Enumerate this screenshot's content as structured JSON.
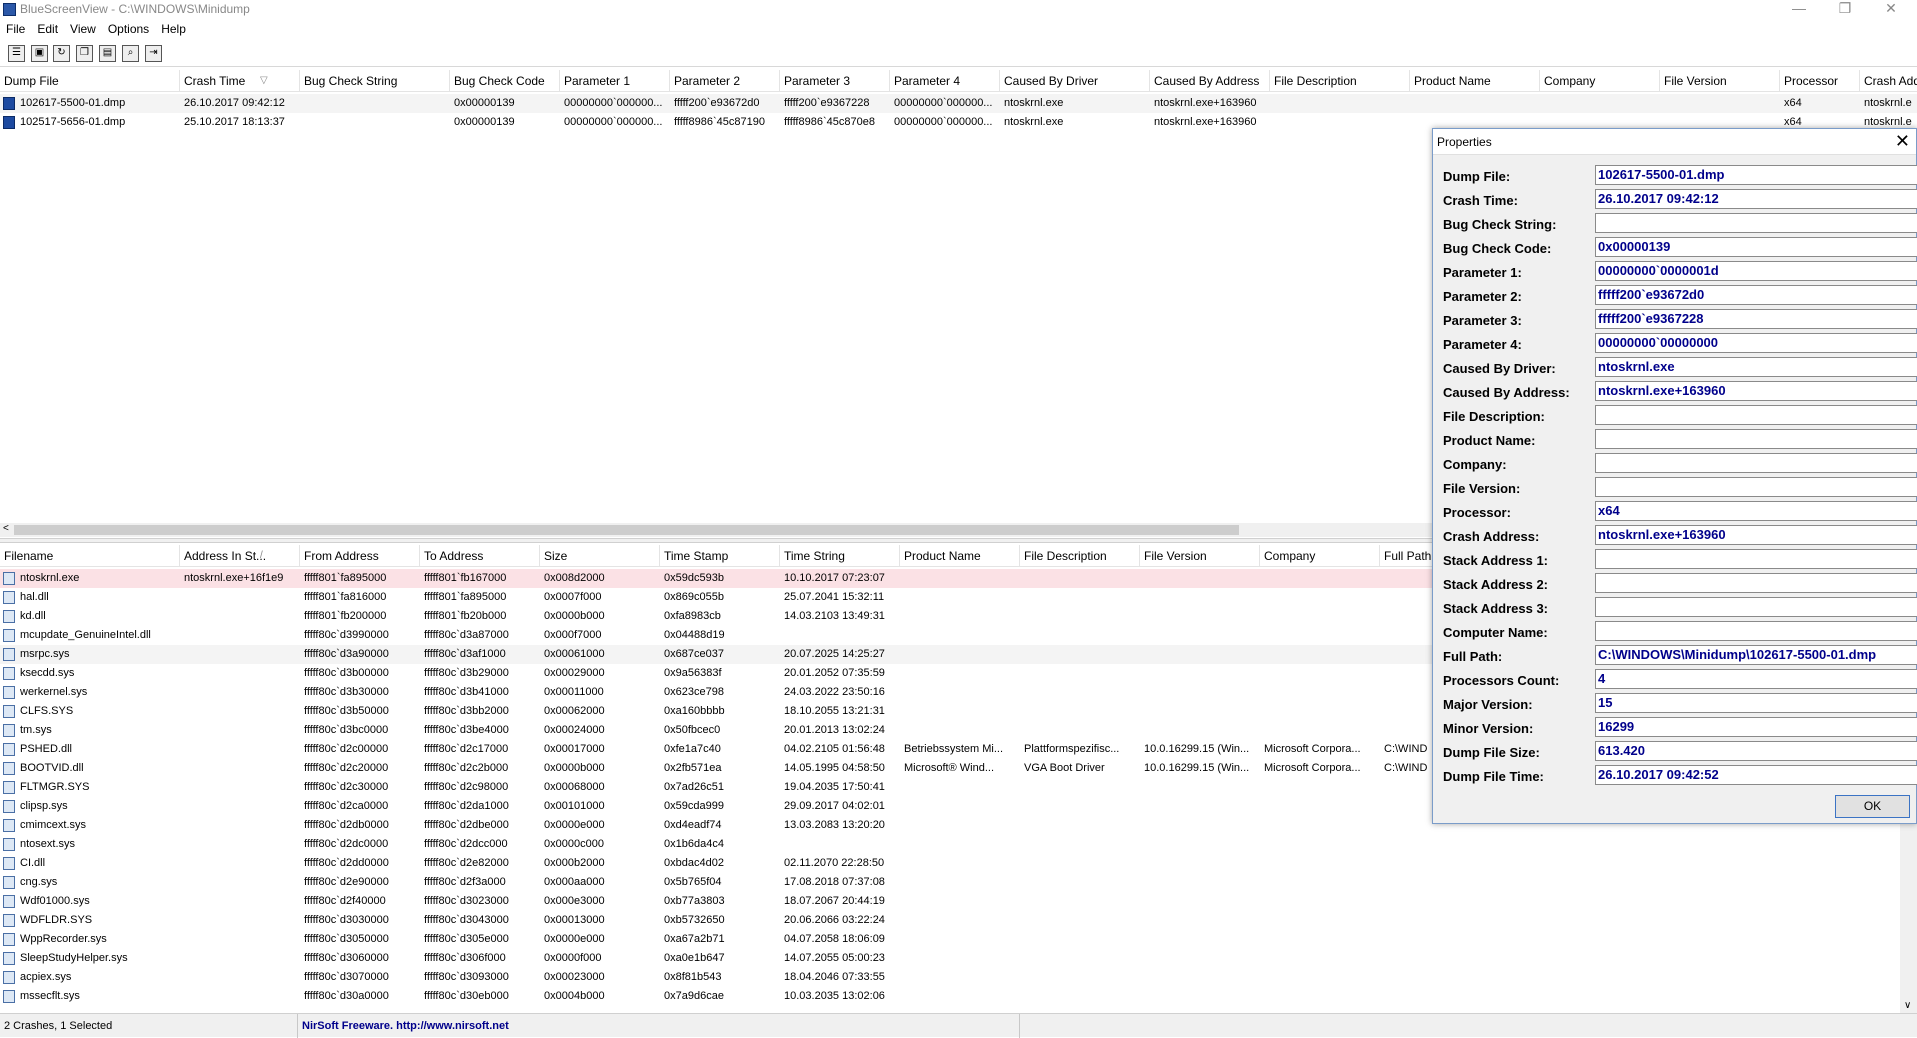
{
  "window": {
    "title": "BlueScreenView  -  C:\\WINDOWS\\Minidump",
    "min": "—",
    "max": "❐",
    "close": "✕"
  },
  "menu": [
    "File",
    "Edit",
    "View",
    "Options",
    "Help"
  ],
  "upper": {
    "columns": [
      "Dump File",
      "Crash Time",
      "Bug Check String",
      "Bug Check Code",
      "Parameter 1",
      "Parameter 2",
      "Parameter 3",
      "Parameter 4",
      "Caused By Driver",
      "Caused By Address",
      "File Description",
      "Product Name",
      "Company",
      "File Version",
      "Processor",
      "Crash Add"
    ],
    "sort_marker": "▽",
    "rows": [
      [
        "102617-5500-01.dmp",
        "26.10.2017 09:42:12",
        "",
        "0x00000139",
        "00000000`000000...",
        "fffff200`e93672d0",
        "fffff200`e9367228",
        "00000000`000000...",
        "ntoskrnl.exe",
        "ntoskrnl.exe+163960",
        "",
        "",
        "",
        "",
        "x64",
        "ntoskrnl.e"
      ],
      [
        "102517-5656-01.dmp",
        "25.10.2017 18:13:37",
        "",
        "0x00000139",
        "00000000`000000...",
        "fffff8986`45c87190",
        "fffff8986`45c870e8",
        "00000000`000000...",
        "ntoskrnl.exe",
        "ntoskrnl.exe+163960",
        "",
        "",
        "",
        "",
        "x64",
        "ntoskrnl.e"
      ]
    ]
  },
  "lower": {
    "columns": [
      "Filename",
      "Address In St...",
      "From Address",
      "To Address",
      "Size",
      "Time Stamp",
      "Time String",
      "Product Name",
      "File Description",
      "File Version",
      "Company",
      "Full Path"
    ],
    "sort_marker": "/",
    "rows": [
      [
        "ntoskrnl.exe",
        "ntoskrnl.exe+16f1e9",
        "fffff801`fa895000",
        "fffff801`fb167000",
        "0x008d2000",
        "0x59dc593b",
        "10.10.2017 07:23:07",
        "",
        "",
        "",
        "",
        ""
      ],
      [
        "hal.dll",
        "",
        "fffff801`fa816000",
        "fffff801`fa895000",
        "0x0007f000",
        "0x869c055b",
        "25.07.2041 15:32:11",
        "",
        "",
        "",
        "",
        ""
      ],
      [
        "kd.dll",
        "",
        "fffff801`fb200000",
        "fffff801`fb20b000",
        "0x0000b000",
        "0xfa8983cb",
        "14.03.2103 13:49:31",
        "",
        "",
        "",
        "",
        ""
      ],
      [
        "mcupdate_GenuineIntel.dll",
        "",
        "fffff80c`d3990000",
        "fffff80c`d3a87000",
        "0x000f7000",
        "0x04488d19",
        "",
        "",
        "",
        "",
        "",
        ""
      ],
      [
        "msrpc.sys",
        "",
        "fffff80c`d3a90000",
        "fffff80c`d3af1000",
        "0x00061000",
        "0x687ce037",
        "20.07.2025 14:25:27",
        "",
        "",
        "",
        "",
        ""
      ],
      [
        "ksecdd.sys",
        "",
        "fffff80c`d3b00000",
        "fffff80c`d3b29000",
        "0x00029000",
        "0x9a56383f",
        "20.01.2052 07:35:59",
        "",
        "",
        "",
        "",
        ""
      ],
      [
        "werkernel.sys",
        "",
        "fffff80c`d3b30000",
        "fffff80c`d3b41000",
        "0x00011000",
        "0x623ce798",
        "24.03.2022 23:50:16",
        "",
        "",
        "",
        "",
        ""
      ],
      [
        "CLFS.SYS",
        "",
        "fffff80c`d3b50000",
        "fffff80c`d3bb2000",
        "0x00062000",
        "0xa160bbbb",
        "18.10.2055 13:21:31",
        "",
        "",
        "",
        "",
        ""
      ],
      [
        "tm.sys",
        "",
        "fffff80c`d3bc0000",
        "fffff80c`d3be4000",
        "0x00024000",
        "0x50fbcec0",
        "20.01.2013 13:02:24",
        "",
        "",
        "",
        "",
        ""
      ],
      [
        "PSHED.dll",
        "",
        "fffff80c`d2c00000",
        "fffff80c`d2c17000",
        "0x00017000",
        "0xfe1a7c40",
        "04.02.2105 01:56:48",
        "Betriebssystem Mi...",
        "Plattformspezifisc...",
        "10.0.16299.15 (Win...",
        "Microsoft Corpora...",
        "C:\\WIND"
      ],
      [
        "BOOTVID.dll",
        "",
        "fffff80c`d2c20000",
        "fffff80c`d2c2b000",
        "0x0000b000",
        "0x2fb571ea",
        "14.05.1995 04:58:50",
        "Microsoft® Wind...",
        "VGA Boot Driver",
        "10.0.16299.15 (Win...",
        "Microsoft Corpora...",
        "C:\\WIND"
      ],
      [
        "FLTMGR.SYS",
        "",
        "fffff80c`d2c30000",
        "fffff80c`d2c98000",
        "0x00068000",
        "0x7ad26c51",
        "19.04.2035 17:50:41",
        "",
        "",
        "",
        "",
        ""
      ],
      [
        "clipsp.sys",
        "",
        "fffff80c`d2ca0000",
        "fffff80c`d2da1000",
        "0x00101000",
        "0x59cda999",
        "29.09.2017 04:02:01",
        "",
        "",
        "",
        "",
        ""
      ],
      [
        "cmimcext.sys",
        "",
        "fffff80c`d2db0000",
        "fffff80c`d2dbe000",
        "0x0000e000",
        "0xd4eadf74",
        "13.03.2083 13:20:20",
        "",
        "",
        "",
        "",
        ""
      ],
      [
        "ntosext.sys",
        "",
        "fffff80c`d2dc0000",
        "fffff80c`d2dcc000",
        "0x0000c000",
        "0x1b6da4c4",
        "",
        "",
        "",
        "",
        "",
        ""
      ],
      [
        "CI.dll",
        "",
        "fffff80c`d2dd0000",
        "fffff80c`d2e82000",
        "0x000b2000",
        "0xbdac4d02",
        "02.11.2070 22:28:50",
        "",
        "",
        "",
        "",
        ""
      ],
      [
        "cng.sys",
        "",
        "fffff80c`d2e90000",
        "fffff80c`d2f3a000",
        "0x000aa000",
        "0x5b765f04",
        "17.08.2018 07:37:08",
        "",
        "",
        "",
        "",
        ""
      ],
      [
        "Wdf01000.sys",
        "",
        "fffff80c`d2f40000",
        "fffff80c`d3023000",
        "0x000e3000",
        "0xb77a3803",
        "18.07.2067 20:44:19",
        "",
        "",
        "",
        "",
        ""
      ],
      [
        "WDFLDR.SYS",
        "",
        "fffff80c`d3030000",
        "fffff80c`d3043000",
        "0x00013000",
        "0xb5732650",
        "20.06.2066 03:22:24",
        "",
        "",
        "",
        "",
        ""
      ],
      [
        "WppRecorder.sys",
        "",
        "fffff80c`d3050000",
        "fffff80c`d305e000",
        "0x0000e000",
        "0xa67a2b71",
        "04.07.2058 18:06:09",
        "",
        "",
        "",
        "",
        ""
      ],
      [
        "SleepStudyHelper.sys",
        "",
        "fffff80c`d3060000",
        "fffff80c`d306f000",
        "0x0000f000",
        "0xa0e1b647",
        "14.07.2055 05:00:23",
        "",
        "",
        "",
        "",
        ""
      ],
      [
        "acpiex.sys",
        "",
        "fffff80c`d3070000",
        "fffff80c`d3093000",
        "0x00023000",
        "0x8f81b543",
        "18.04.2046 07:33:55",
        "",
        "",
        "",
        "",
        ""
      ],
      [
        "mssecflt.sys",
        "",
        "fffff80c`d30a0000",
        "fffff80c`d30eb000",
        "0x0004b000",
        "0x7a9d6cae",
        "10.03.2035 13:02:06",
        "",
        "",
        "",
        "",
        ""
      ]
    ]
  },
  "status": {
    "count": "2 Crashes, 1 Selected",
    "credit": "NirSoft Freeware.  http://www.nirsoft.net"
  },
  "properties": {
    "title": "Properties",
    "close": "✕",
    "ok": "OK",
    "fields": [
      {
        "label": "Dump File:",
        "value": "102617-5500-01.dmp"
      },
      {
        "label": "Crash Time:",
        "value": "26.10.2017 09:42:12"
      },
      {
        "label": "Bug Check String:",
        "value": ""
      },
      {
        "label": "Bug Check Code:",
        "value": "0x00000139"
      },
      {
        "label": "Parameter 1:",
        "value": "00000000`0000001d"
      },
      {
        "label": "Parameter 2:",
        "value": "fffff200`e93672d0"
      },
      {
        "label": "Parameter 3:",
        "value": "fffff200`e9367228"
      },
      {
        "label": "Parameter 4:",
        "value": "00000000`00000000"
      },
      {
        "label": "Caused By Driver:",
        "value": "ntoskrnl.exe"
      },
      {
        "label": "Caused By Address:",
        "value": "ntoskrnl.exe+163960"
      },
      {
        "label": "File Description:",
        "value": ""
      },
      {
        "label": "Product Name:",
        "value": ""
      },
      {
        "label": "Company:",
        "value": ""
      },
      {
        "label": "File Version:",
        "value": ""
      },
      {
        "label": "Processor:",
        "value": "x64"
      },
      {
        "label": "Crash Address:",
        "value": "ntoskrnl.exe+163960"
      },
      {
        "label": "Stack Address 1:",
        "value": ""
      },
      {
        "label": "Stack Address 2:",
        "value": ""
      },
      {
        "label": "Stack Address 3:",
        "value": ""
      },
      {
        "label": "Computer Name:",
        "value": ""
      },
      {
        "label": "Full Path:",
        "value": "C:\\WINDOWS\\Minidump\\102617-5500-01.dmp"
      },
      {
        "label": "Processors Count:",
        "value": "4"
      },
      {
        "label": "Major Version:",
        "value": "15"
      },
      {
        "label": "Minor Version:",
        "value": "16299"
      },
      {
        "label": "Dump File Size:",
        "value": "613.420"
      },
      {
        "label": "Dump File Time:",
        "value": "26.10.2017 09:42:52"
      }
    ]
  },
  "toolbar_icons": [
    "properties-icon",
    "save-icon",
    "refresh-icon",
    "copy-icon",
    "html-report-icon",
    "find-icon",
    "exit-icon"
  ],
  "colors": {
    "value_text": "#00008b",
    "highlight_row": "#fbe1e5",
    "link": "#00008b"
  }
}
